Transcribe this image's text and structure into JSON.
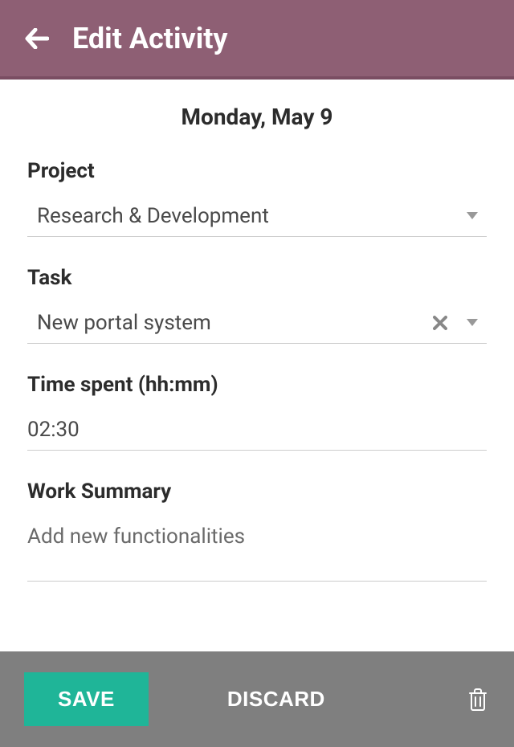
{
  "header": {
    "title": "Edit Activity"
  },
  "date": "Monday, May 9",
  "fields": {
    "project": {
      "label": "Project",
      "value": "Research & Development"
    },
    "task": {
      "label": "Task",
      "value": "New portal system"
    },
    "timeSpent": {
      "label": "Time spent (hh:mm)",
      "value": "02:30"
    },
    "workSummary": {
      "label": "Work Summary",
      "value": "Add new functionalities"
    }
  },
  "footer": {
    "save": "SAVE",
    "discard": "DISCARD"
  }
}
